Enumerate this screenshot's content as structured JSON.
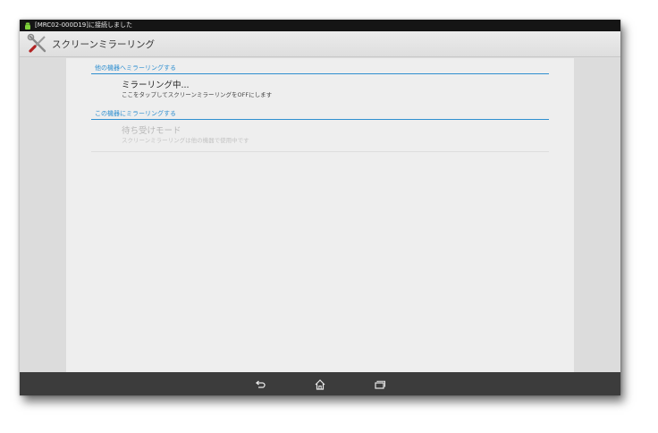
{
  "status_bar": {
    "notification_text": "[MRC02-000D19]に接続しました"
  },
  "action_bar": {
    "title": "スクリーンミラーリング",
    "app_icon": "tools-icon"
  },
  "sections": [
    {
      "header": "他の機器へミラーリングする",
      "item": {
        "title": "ミラーリング中...",
        "subtitle": "ここをタップしてスクリーンミラーリングをOFFにします",
        "enabled": true
      }
    },
    {
      "header": "この機器にミラーリングする",
      "item": {
        "title": "待ち受けモード",
        "subtitle": "スクリーンミラーリングは他の機器で使用中です",
        "enabled": false
      }
    }
  ],
  "nav_bar": {
    "buttons": [
      "back-icon",
      "home-icon",
      "recent-apps-icon"
    ]
  },
  "colors": {
    "accent": "#2f8fd0",
    "status_bar": "#151515",
    "nav_bar": "#3c3c3c"
  }
}
